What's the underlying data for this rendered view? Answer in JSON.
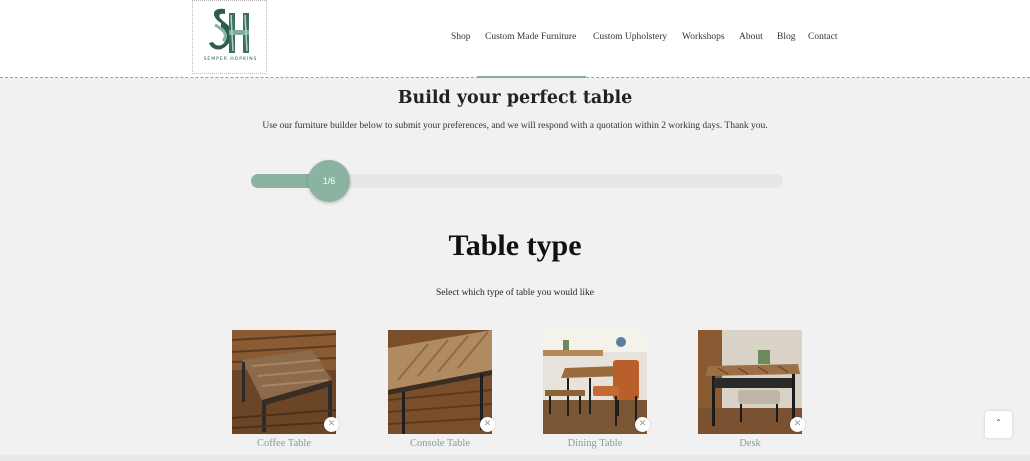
{
  "logo": {
    "text": "SEMPER HOPKINS",
    "monogram": "SH"
  },
  "nav": {
    "items": [
      {
        "id": "shop",
        "label": "Shop"
      },
      {
        "id": "custom-made-furniture",
        "label": "Custom Made Furniture"
      },
      {
        "id": "custom-upholstery",
        "label": "Custom Upholstery"
      },
      {
        "id": "workshops",
        "label": "Workshops"
      },
      {
        "id": "about",
        "label": "About"
      },
      {
        "id": "blog",
        "label": "Blog"
      },
      {
        "id": "contact",
        "label": "Contact"
      }
    ],
    "active": "Custom Made Furniture"
  },
  "builder": {
    "title": "Build your perfect table",
    "subtitle": "Use our furniture builder below to submit your preferences, and we will respond with a quotation within 2 working days. Thank you.",
    "progress": {
      "label": "1/6",
      "fraction": 0.1667
    }
  },
  "step": {
    "title": "Table type",
    "description": "Select which type of table you would like",
    "options": [
      {
        "label": "Coffee Table",
        "close_icon": "✕"
      },
      {
        "label": "Console Table",
        "close_icon": "✕"
      },
      {
        "label": "Dining Table",
        "close_icon": "✕"
      },
      {
        "label": "Desk",
        "close_icon": "✕"
      }
    ]
  },
  "scroll_top": {
    "icon": "chevron-up-icon",
    "glyph": "ˆ"
  },
  "colors": {
    "accent": "#8bb3a1",
    "accent_text": "#7aa592",
    "background": "#f1f1f1"
  }
}
